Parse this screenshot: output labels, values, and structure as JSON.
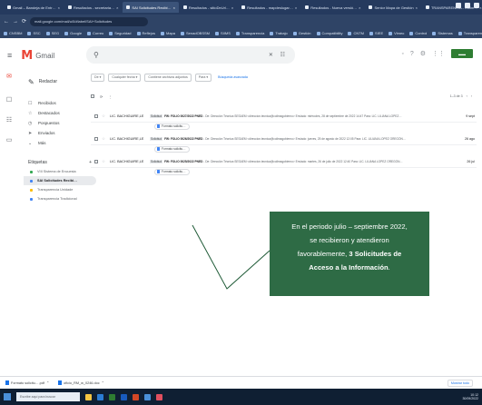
{
  "browser": {
    "tabs": [
      {
        "label": "Gmail – Bandeja de Entr…"
      },
      {
        "label": "Resultados - secretaria…"
      },
      {
        "label": "SAI Solicitudes Recibi…",
        "active": true
      },
      {
        "label": "Resultados - sitioDeUrl…"
      },
      {
        "label": "Resultados - mapdeslugar…"
      },
      {
        "label": "Resultados - Nueva versió…"
      },
      {
        "label": "Senior Mapa de Gestión"
      },
      {
        "label": "TRANSPARENCIA - Colim…"
      }
    ],
    "url": "mail.google.com/mail/u/0/#label/SAI+Solicitudes",
    "bookmarks": [
      "CNSBM",
      "SSC",
      "SEG",
      "Google",
      "Correo",
      "Seguridad",
      "Reflejos",
      "Mapa",
      "SenadOBSSM",
      "SIIMS",
      "Transparencia",
      "Trabajo",
      "Gestión",
      "Compatibility",
      "CNTM",
      "SIEE",
      "Vimeo",
      "Control",
      "Sistemas",
      "Transparencia Municipal"
    ]
  },
  "gmail": {
    "logo_text": "Gmail",
    "compose_label": "Redactar",
    "nav": [
      {
        "icon": "inbox-icon",
        "glyph": "☐",
        "label": "Recibidos"
      },
      {
        "icon": "star-icon",
        "glyph": "☆",
        "label": "Destacados"
      },
      {
        "icon": "clock-icon",
        "glyph": "◷",
        "label": "Pospuestos"
      },
      {
        "icon": "send-icon",
        "glyph": "➤",
        "label": "Enviados"
      },
      {
        "icon": "chevron-down-icon",
        "glyph": "⌄",
        "label": "Más"
      }
    ],
    "labels_title": "Etiquetas",
    "labels_add": "+",
    "labels": [
      {
        "label": "VIII Sistema de Encuesta",
        "color": "#34a853",
        "selected": false
      },
      {
        "label": "SAI Solicitudes Recibi…",
        "color": "#4285f4",
        "selected": true
      },
      {
        "label": "Transparencia Unidade",
        "color": "#fbbc04",
        "selected": false
      },
      {
        "label": "Transparencia Tradicional",
        "color": "#4285f4",
        "selected": false
      }
    ],
    "filters": [
      "De ▾",
      "Cualquier fecha ▾",
      "Contiene archivos adjuntos",
      "Para ▾",
      "Búsqueda avanzada"
    ],
    "pager_text": "1–3 de 3",
    "emails": [
      {
        "sender": "LIC. BACHIGUIRE,LE",
        "tag": "Solicitud",
        "subject": "FW: FOLIO 0027/2022 PNED",
        "snippet": " - De: Dirección Técnica SESAEM <direccion.tecnica@colimagobierno> Enviado: miércoles, 28 de septiembre de 2022 14:47 Para: LIC. LILIANA LOPEZ…",
        "date": "9 sept",
        "attachment": "Formato solicitu…"
      },
      {
        "sender": "LIC. BACHIGUIRE,LE",
        "tag": "Solicitud",
        "subject": "FW: FOLIO 0026/2022 PNED",
        "snippet": " - De: Dirección Técnica SESAEM <direccion.tecnica@colimagobierno> Enviado: jueves, 25 de agosto de 2022 12:05 Para: LIC. LILIANA LOPEZ OREGÓN…",
        "date": "26 ago",
        "attachment": "Formato solicitu…"
      },
      {
        "sender": "LIC. BACHIGUIRE,LE",
        "tag": "Solicitud",
        "subject": "FW: FOLIO 0025/2022 PNED",
        "snippet": " - De: Dirección Técnica SESAEM <direccion.tecnica@colimagobierno> Enviado: martes, 26 de julio de 2022 12:40 Para: LIC. LILIANA LOPEZ OREGÓN…",
        "date": "26 jul",
        "attachment": "Formato solicitu…"
      }
    ]
  },
  "callout": {
    "line1": "En el periodo julio – septiembre 2022,",
    "line2": "se recibieron y atendieron",
    "line3_normal": "favorablemente, ",
    "line3_bold": "3 Solicitudes de",
    "line4": "Acceso a la Información",
    "line4_end": "."
  },
  "downloads": {
    "items": [
      "Formato solicitu….pdf",
      "oficio_RM_w_0246.doc"
    ],
    "show_all": "Mostrar todo"
  },
  "taskbar": {
    "search_placeholder": "Escribe aquí para buscar",
    "clock_time": "10:12",
    "clock_date": "30/09/2022"
  }
}
